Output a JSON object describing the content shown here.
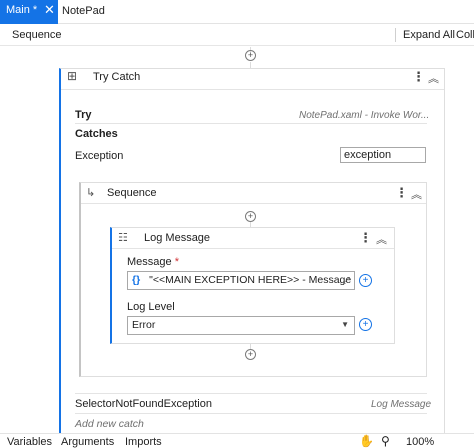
{
  "tabs": [
    {
      "label": "Main *",
      "active": true
    },
    {
      "label": "NotePad",
      "active": false
    }
  ],
  "breadcrumb": "Sequence",
  "toolbar": {
    "expand_all": "Expand All",
    "collapse_all": "Coll"
  },
  "try_catch": {
    "title": "Try Catch",
    "try_label": "Try",
    "try_value": "NotePad.xaml - Invoke Wor...",
    "catches_label": "Catches",
    "exception_label": "Exception",
    "exception_value": "exception",
    "sequence": {
      "title": "Sequence",
      "log_message": {
        "title": "Log Message",
        "message_label": "Message",
        "required_mark": "*",
        "message_value": "\"<<MAIN EXCEPTION HERE>> - Message",
        "level_label": "Log Level",
        "level_value": "Error"
      }
    },
    "selector_exception": "SelectorNotFoundException",
    "selector_activity": "Log Message",
    "add_catch": "Add new catch"
  },
  "statusbar": {
    "variables": "Variables",
    "arguments": "Arguments",
    "imports": "Imports",
    "zoom": "100%"
  },
  "colors": {
    "accent": "#1473e6"
  }
}
